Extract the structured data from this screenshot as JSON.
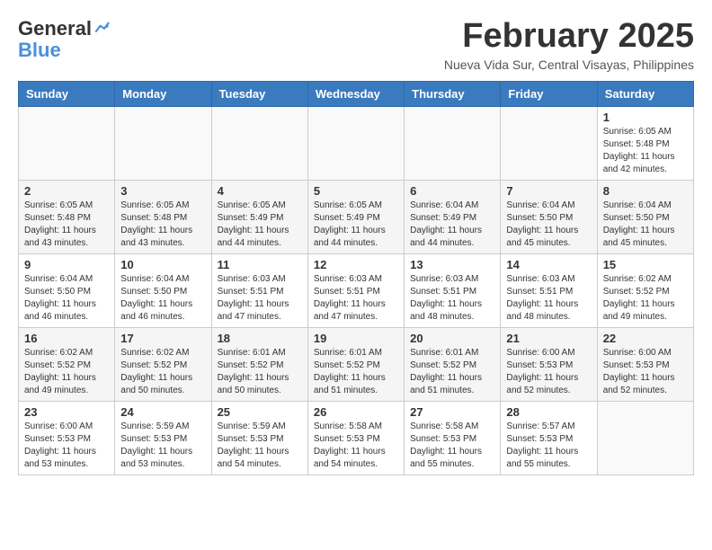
{
  "logo": {
    "line1": "General",
    "line2": "Blue"
  },
  "title": "February 2025",
  "location": "Nueva Vida Sur, Central Visayas, Philippines",
  "headers": [
    "Sunday",
    "Monday",
    "Tuesday",
    "Wednesday",
    "Thursday",
    "Friday",
    "Saturday"
  ],
  "weeks": [
    [
      {
        "day": "",
        "info": ""
      },
      {
        "day": "",
        "info": ""
      },
      {
        "day": "",
        "info": ""
      },
      {
        "day": "",
        "info": ""
      },
      {
        "day": "",
        "info": ""
      },
      {
        "day": "",
        "info": ""
      },
      {
        "day": "1",
        "info": "Sunrise: 6:05 AM\nSunset: 5:48 PM\nDaylight: 11 hours\nand 42 minutes."
      }
    ],
    [
      {
        "day": "2",
        "info": "Sunrise: 6:05 AM\nSunset: 5:48 PM\nDaylight: 11 hours\nand 43 minutes."
      },
      {
        "day": "3",
        "info": "Sunrise: 6:05 AM\nSunset: 5:48 PM\nDaylight: 11 hours\nand 43 minutes."
      },
      {
        "day": "4",
        "info": "Sunrise: 6:05 AM\nSunset: 5:49 PM\nDaylight: 11 hours\nand 44 minutes."
      },
      {
        "day": "5",
        "info": "Sunrise: 6:05 AM\nSunset: 5:49 PM\nDaylight: 11 hours\nand 44 minutes."
      },
      {
        "day": "6",
        "info": "Sunrise: 6:04 AM\nSunset: 5:49 PM\nDaylight: 11 hours\nand 44 minutes."
      },
      {
        "day": "7",
        "info": "Sunrise: 6:04 AM\nSunset: 5:50 PM\nDaylight: 11 hours\nand 45 minutes."
      },
      {
        "day": "8",
        "info": "Sunrise: 6:04 AM\nSunset: 5:50 PM\nDaylight: 11 hours\nand 45 minutes."
      }
    ],
    [
      {
        "day": "9",
        "info": "Sunrise: 6:04 AM\nSunset: 5:50 PM\nDaylight: 11 hours\nand 46 minutes."
      },
      {
        "day": "10",
        "info": "Sunrise: 6:04 AM\nSunset: 5:50 PM\nDaylight: 11 hours\nand 46 minutes."
      },
      {
        "day": "11",
        "info": "Sunrise: 6:03 AM\nSunset: 5:51 PM\nDaylight: 11 hours\nand 47 minutes."
      },
      {
        "day": "12",
        "info": "Sunrise: 6:03 AM\nSunset: 5:51 PM\nDaylight: 11 hours\nand 47 minutes."
      },
      {
        "day": "13",
        "info": "Sunrise: 6:03 AM\nSunset: 5:51 PM\nDaylight: 11 hours\nand 48 minutes."
      },
      {
        "day": "14",
        "info": "Sunrise: 6:03 AM\nSunset: 5:51 PM\nDaylight: 11 hours\nand 48 minutes."
      },
      {
        "day": "15",
        "info": "Sunrise: 6:02 AM\nSunset: 5:52 PM\nDaylight: 11 hours\nand 49 minutes."
      }
    ],
    [
      {
        "day": "16",
        "info": "Sunrise: 6:02 AM\nSunset: 5:52 PM\nDaylight: 11 hours\nand 49 minutes."
      },
      {
        "day": "17",
        "info": "Sunrise: 6:02 AM\nSunset: 5:52 PM\nDaylight: 11 hours\nand 50 minutes."
      },
      {
        "day": "18",
        "info": "Sunrise: 6:01 AM\nSunset: 5:52 PM\nDaylight: 11 hours\nand 50 minutes."
      },
      {
        "day": "19",
        "info": "Sunrise: 6:01 AM\nSunset: 5:52 PM\nDaylight: 11 hours\nand 51 minutes."
      },
      {
        "day": "20",
        "info": "Sunrise: 6:01 AM\nSunset: 5:52 PM\nDaylight: 11 hours\nand 51 minutes."
      },
      {
        "day": "21",
        "info": "Sunrise: 6:00 AM\nSunset: 5:53 PM\nDaylight: 11 hours\nand 52 minutes."
      },
      {
        "day": "22",
        "info": "Sunrise: 6:00 AM\nSunset: 5:53 PM\nDaylight: 11 hours\nand 52 minutes."
      }
    ],
    [
      {
        "day": "23",
        "info": "Sunrise: 6:00 AM\nSunset: 5:53 PM\nDaylight: 11 hours\nand 53 minutes."
      },
      {
        "day": "24",
        "info": "Sunrise: 5:59 AM\nSunset: 5:53 PM\nDaylight: 11 hours\nand 53 minutes."
      },
      {
        "day": "25",
        "info": "Sunrise: 5:59 AM\nSunset: 5:53 PM\nDaylight: 11 hours\nand 54 minutes."
      },
      {
        "day": "26",
        "info": "Sunrise: 5:58 AM\nSunset: 5:53 PM\nDaylight: 11 hours\nand 54 minutes."
      },
      {
        "day": "27",
        "info": "Sunrise: 5:58 AM\nSunset: 5:53 PM\nDaylight: 11 hours\nand 55 minutes."
      },
      {
        "day": "28",
        "info": "Sunrise: 5:57 AM\nSunset: 5:53 PM\nDaylight: 11 hours\nand 55 minutes."
      },
      {
        "day": "",
        "info": ""
      }
    ]
  ]
}
